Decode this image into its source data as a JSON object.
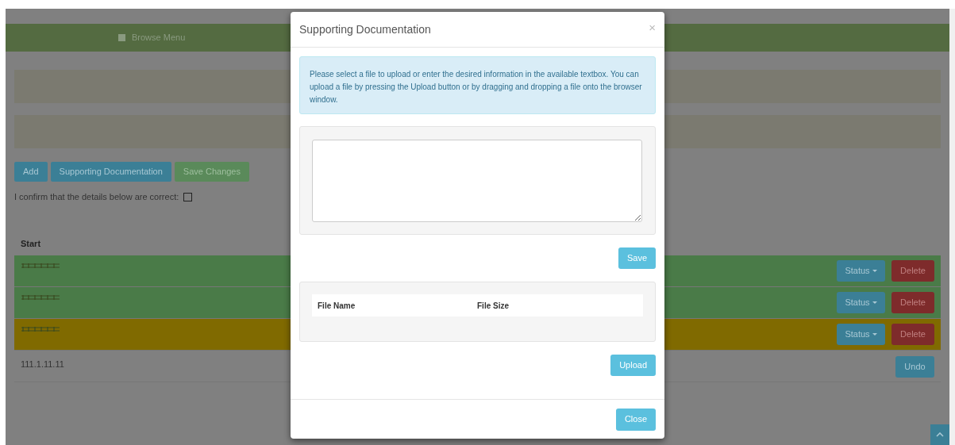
{
  "nav": {
    "label": "Browse Menu"
  },
  "toolbar": {
    "buttons": [
      {
        "label": "Add",
        "kind": "info"
      },
      {
        "label": "Supporting Documentation",
        "kind": "info"
      },
      {
        "label": "Save Changes",
        "kind": "success"
      }
    ]
  },
  "confirm": {
    "label": "I confirm that the details below are correct:",
    "checked": false
  },
  "table": {
    "columns": [
      "Start"
    ],
    "rows": [
      {
        "kind": "added",
        "status_button": "Status",
        "delete_button": "Delete"
      },
      {
        "kind": "added",
        "status_button": "Status",
        "delete_button": "Delete"
      },
      {
        "kind": "changed",
        "status_button": "Status",
        "delete_button": "Delete"
      },
      {
        "kind": "deleted",
        "start": "111.1.11.11",
        "undo_button": "Undo"
      }
    ]
  },
  "modal": {
    "title": "Supporting Documentation",
    "close_icon": "×",
    "info": "Please select a file to upload or enter the desired information in the available textbox. You can upload a file by pressing the Upload button or by dragging and dropping a file onto the browser window.",
    "save_button": "Save",
    "files_table": {
      "columns": [
        "File Name",
        "File Size"
      ]
    },
    "upload_button": "Upload",
    "footer_button": "Close"
  }
}
